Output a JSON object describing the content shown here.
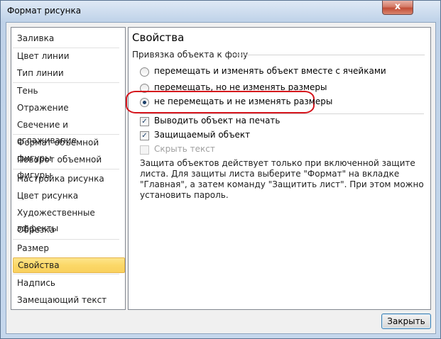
{
  "window": {
    "title": "Формат рисунка",
    "close_glyph": "x"
  },
  "nav": {
    "items": [
      {
        "label": "Заливка"
      },
      {
        "label": "Цвет линии"
      },
      {
        "label": "Тип линии"
      },
      {
        "label": "Тень"
      },
      {
        "label": "Отражение"
      },
      {
        "label": "Свечение и сглаживание"
      },
      {
        "label": "Формат объемной фигуры"
      },
      {
        "label": "Поворот объемной фигуры"
      },
      {
        "label": "Настройка рисунка"
      },
      {
        "label": "Цвет рисунка"
      },
      {
        "label": "Художественные эффекты"
      },
      {
        "label": "Обрезка"
      },
      {
        "label": "Размер"
      },
      {
        "label": "Свойства"
      },
      {
        "label": "Надпись"
      },
      {
        "label": "Замещающий текст"
      }
    ],
    "selected": "Свойства"
  },
  "panel": {
    "title": "Свойства",
    "anchor_group_label": "Привязка объекта к фону",
    "radio_options": [
      {
        "label": "перемещать и изменять объект вместе с ячейками",
        "checked": false
      },
      {
        "label": "перемещать, но не изменять размеры",
        "checked": false
      },
      {
        "label": "не перемещать и не изменять размеры",
        "checked": true
      }
    ],
    "checkboxes": [
      {
        "label": "Выводить объект на печать",
        "checked": true,
        "enabled": true
      },
      {
        "label": "Защищаемый объект",
        "checked": true,
        "enabled": true
      },
      {
        "label": "Скрыть текст",
        "checked": false,
        "enabled": false
      }
    ],
    "info_text": "Защита объектов действует только при включенной защите листа. Для защиты листа выберите \"Формат\" на вкладке \"Главная\", а затем команду \"Защитить лист\". При этом можно установить пароль."
  },
  "footer": {
    "close_label": "Закрыть"
  },
  "colors": {
    "selection": "#fbd868",
    "annotation_ellipse": "#d5141c"
  }
}
